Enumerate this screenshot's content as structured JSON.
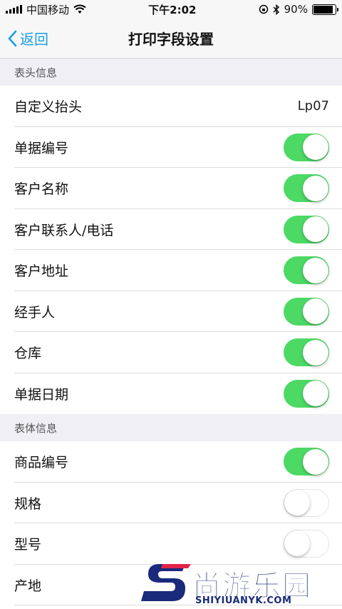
{
  "status_bar": {
    "carrier": "中国移动",
    "time": "下午2:02",
    "battery_percent": "90%",
    "battery_level": 0.9
  },
  "nav": {
    "back_label": "返回",
    "title": "打印字段设置"
  },
  "sections": [
    {
      "header": "表头信息",
      "rows": [
        {
          "label": "自定义抬头",
          "value": "Lp07"
        },
        {
          "label": "单据编号",
          "toggle": true
        },
        {
          "label": "客户名称",
          "toggle": true
        },
        {
          "label": "客户联系人/电话",
          "toggle": true
        },
        {
          "label": "客户地址",
          "toggle": true
        },
        {
          "label": "经手人",
          "toggle": true
        },
        {
          "label": "仓库",
          "toggle": true
        },
        {
          "label": "单据日期",
          "toggle": true
        }
      ]
    },
    {
      "header": "表体信息",
      "rows": [
        {
          "label": "商品编号",
          "toggle": true
        },
        {
          "label": "规格",
          "toggle": false
        },
        {
          "label": "型号",
          "toggle": false
        },
        {
          "label": "产地"
        }
      ]
    }
  ],
  "watermark": {
    "text": "尚游乐园",
    "sub": "SHIYIUANYK.COM"
  },
  "colors": {
    "accent": "#1a9fe6",
    "toggle_on": "#4cd964",
    "section_bg": "#efeff4"
  }
}
